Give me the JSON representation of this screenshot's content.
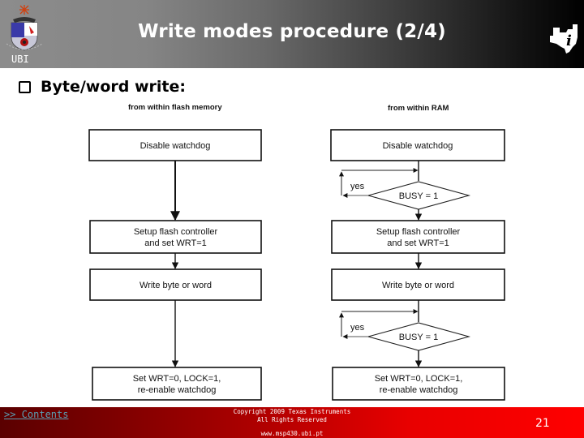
{
  "header": {
    "title": "Write modes procedure (2/4)",
    "left_logo_label": "UBI",
    "left_logo_icon": "university-crest-icon",
    "right_logo_icon": "texas-instruments-logo-icon"
  },
  "content": {
    "bullet_icon": "checkbox-bullet-icon",
    "heading": "Byte/word write:"
  },
  "diagram": {
    "left_column": {
      "label": "from within flash memory",
      "steps": [
        {
          "type": "process",
          "lines": [
            "Disable watchdog"
          ]
        },
        {
          "type": "process",
          "lines": [
            "Setup flash controller",
            "and set WRT=1"
          ]
        },
        {
          "type": "process",
          "lines": [
            "Write byte or word"
          ]
        },
        {
          "type": "process",
          "lines": [
            "Set WRT=0, LOCK=1,",
            "re-enable  watchdog"
          ]
        }
      ]
    },
    "right_column": {
      "label": "from within RAM",
      "steps": [
        {
          "type": "process",
          "lines": [
            "Disable  watchdog"
          ]
        },
        {
          "type": "decision",
          "lines": [
            "BUSY = 1"
          ],
          "loop_label": "yes"
        },
        {
          "type": "process",
          "lines": [
            "Setup flash controller",
            "and set WRT=1"
          ]
        },
        {
          "type": "process",
          "lines": [
            "Write byte or word"
          ]
        },
        {
          "type": "decision",
          "lines": [
            "BUSY = 1"
          ],
          "loop_label": "yes"
        },
        {
          "type": "process",
          "lines": [
            "Set WRT=0, LOCK=1,",
            "re-enable  watchdog"
          ]
        }
      ]
    }
  },
  "footer": {
    "contents_link": ">> Contents",
    "copyright_line1": "Copyright  2009 Texas Instruments",
    "copyright_line2": "All Rights Reserved",
    "website": "www.msp430.ubi.pt",
    "page_number": "21"
  }
}
